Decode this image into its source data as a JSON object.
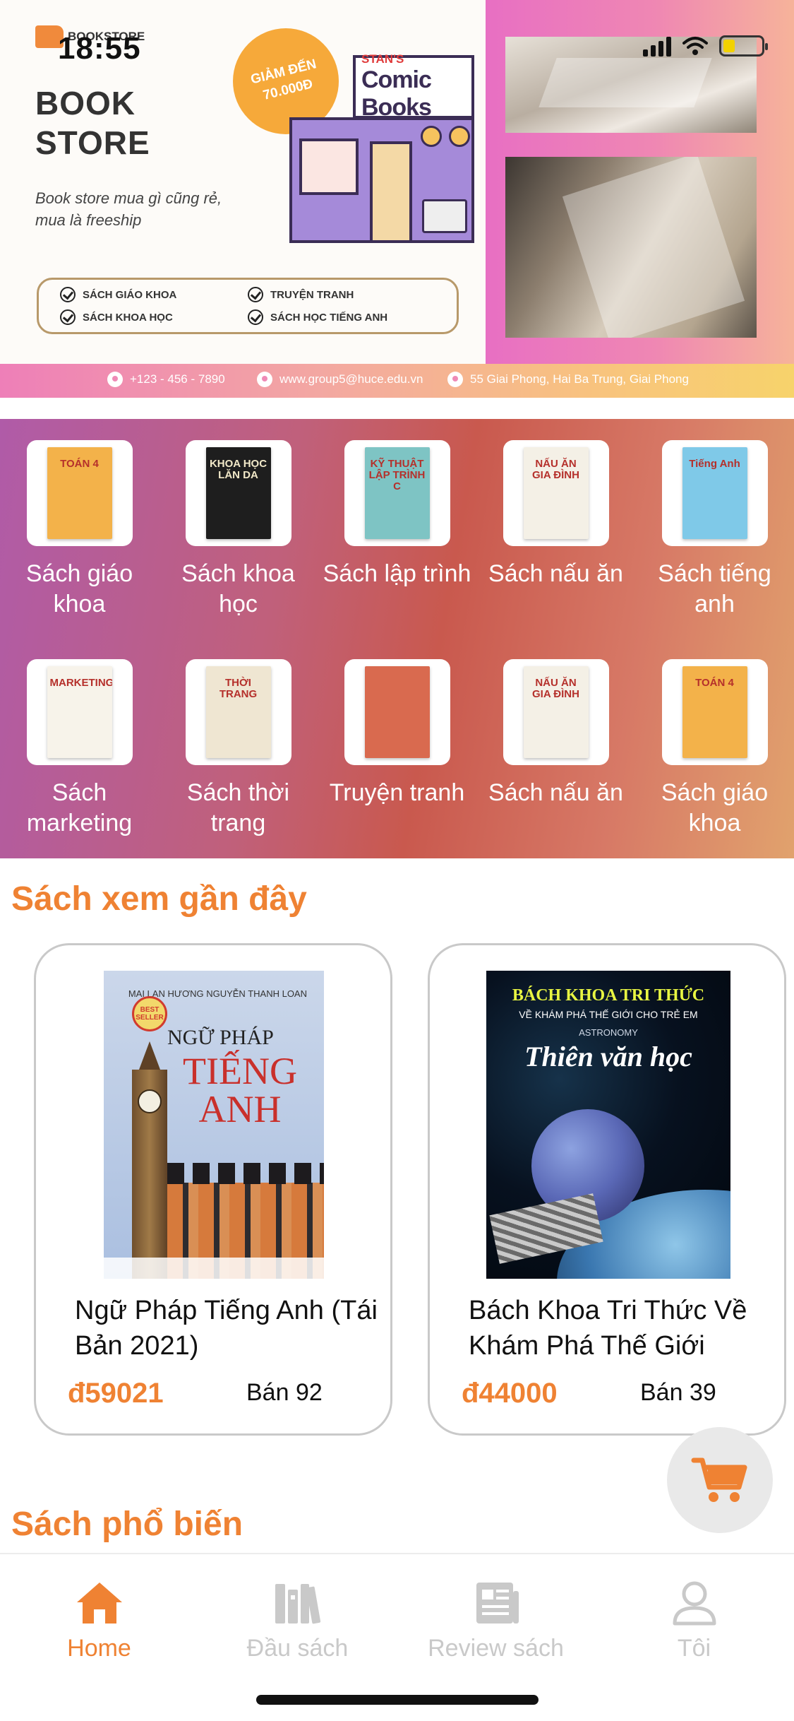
{
  "status_bar": {
    "time": "18:55"
  },
  "banner": {
    "logo_text": "BOOKSTORE",
    "title": "BOOK STORE",
    "tagline": "Book store mua gì cũng rẻ, mua là freeship",
    "promo": "GIẢM ĐẾN 70.000Đ",
    "shop_sign_small": "STAN'S",
    "shop_sign_big": "Comic Books",
    "features": [
      "SÁCH GIÁO KHOA",
      "TRUYỆN TRANH",
      "SÁCH KHOA HỌC",
      "SÁCH HỌC TIẾNG ANH"
    ],
    "contact": {
      "phone": "+123 - 456 - 7890",
      "website": "www.group5@huce.edu.vn",
      "address": "55 Giai Phong, Hai Ba Trung, Giai Phong"
    }
  },
  "categories": [
    {
      "label": "Sách giáo khoa",
      "cover_text": "TOÁN 4",
      "cover_color": "#f3b24a"
    },
    {
      "label": "Sách khoa học",
      "cover_text": "KHOA HỌC LĂN DA",
      "cover_color": "#1e1e1e"
    },
    {
      "label": "Sách lập trình",
      "cover_text": "KỸ THUẬT LẬP TRÌNH C",
      "cover_color": "#7ec4c4"
    },
    {
      "label": "Sách nấu ăn",
      "cover_text": "NẤU ĂN GIA ĐÌNH",
      "cover_color": "#f4f0e6"
    },
    {
      "label": "Sách tiếng anh",
      "cover_text": "Tiếng Anh",
      "cover_color": "#7fc9e8"
    },
    {
      "label": "Sách marketing",
      "cover_text": "MARKETING",
      "cover_color": "#f7f3ea"
    },
    {
      "label": "Sách thời trang",
      "cover_text": "THỜI TRANG",
      "cover_color": "#efe6d2"
    },
    {
      "label": "Truyện tranh",
      "cover_text": "",
      "cover_color": "#d96a4f"
    },
    {
      "label": "Sách nấu ăn",
      "cover_text": "NẤU ĂN GIA ĐÌNH",
      "cover_color": "#f4f0e6"
    },
    {
      "label": "Sách giáo khoa",
      "cover_text": "TOÁN 4",
      "cover_color": "#f3b24a"
    }
  ],
  "recent": {
    "title": "Sách xem gần đây",
    "items": [
      {
        "name": "Ngữ Pháp Tiếng Anh (Tái Bản 2021)",
        "price": "đ59021",
        "sold": "Bán 92",
        "cover": {
          "authors": "MAI LAN HƯƠNG NGUYỄN THANH LOAN",
          "badge": "BEST SELLER",
          "line1": "NGỮ PHÁP",
          "line2": "TIẾNG ANH"
        }
      },
      {
        "name": "Bách Khoa Tri Thức Về Khám Phá Thế Giới",
        "price": "đ44000",
        "sold": "Bán 39",
        "cover": {
          "line1": "BÁCH KHOA TRI THỨC",
          "line2": "VỀ KHÁM PHÁ THẾ GIỚI CHO TRẺ EM",
          "line3": "ASTRONOMY",
          "title": "Thiên văn học"
        }
      }
    ]
  },
  "popular": {
    "title": "Sách phổ biến"
  },
  "nav": [
    {
      "label": "Home",
      "icon": "home-icon",
      "active": true
    },
    {
      "label": "Đầu sách",
      "icon": "library-icon",
      "active": false
    },
    {
      "label": "Review sách",
      "icon": "news-icon",
      "active": false
    },
    {
      "label": "Tôi",
      "icon": "user-icon",
      "active": false
    }
  ],
  "colors": {
    "accent": "#ef8233",
    "inactive": "#c9c9c9",
    "banner_pink": "#e86fc3"
  }
}
